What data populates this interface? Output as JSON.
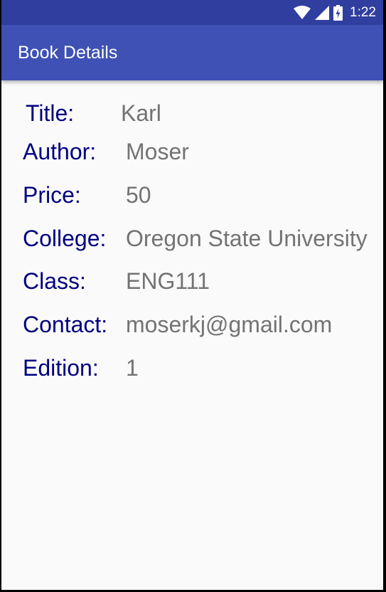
{
  "status_bar": {
    "time": "1:22",
    "icons": [
      "wifi-icon",
      "cellular-signal-icon",
      "battery-charging-icon"
    ]
  },
  "app_bar": {
    "title": "Book Details"
  },
  "details": [
    {
      "label": "Title:",
      "value": "Karl"
    },
    {
      "label": "Author:",
      "value": "Moser"
    },
    {
      "label": "Price:",
      "value": "50"
    },
    {
      "label": "College:",
      "value": "Oregon State University"
    },
    {
      "label": "Class:",
      "value": "ENG111"
    },
    {
      "label": "Contact:",
      "value": "moserkj@gmail.com"
    },
    {
      "label": "Edition:",
      "value": "1"
    }
  ],
  "colors": {
    "status_bar": "#303f9f",
    "app_bar": "#3f51b5",
    "label_text": "#000080",
    "value_text": "#737373",
    "background": "#fafafa"
  }
}
